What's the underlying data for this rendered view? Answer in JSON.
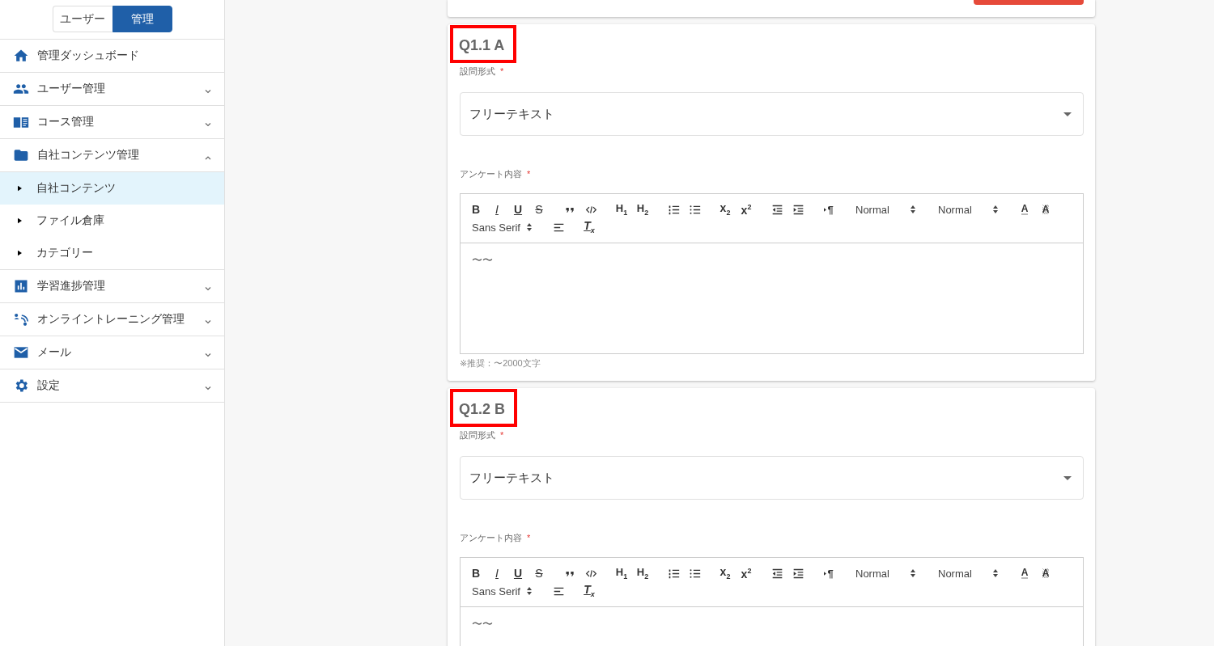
{
  "mode_toggle": [
    {
      "label": "ユーザー",
      "selected": false
    },
    {
      "label": "管理",
      "selected": true
    }
  ],
  "sidebar": {
    "items": [
      {
        "kind": "link",
        "label": "管理ダッシュボード"
      },
      {
        "kind": "group",
        "label": "ユーザー管理",
        "expanded": false
      },
      {
        "kind": "group",
        "label": "コース管理",
        "expanded": false
      },
      {
        "kind": "group",
        "label": "自社コンテンツ管理",
        "expanded": true,
        "children": [
          {
            "label": "自社コンテンツ",
            "selected": true
          },
          {
            "label": "ファイル倉庫",
            "selected": false
          },
          {
            "label": "カテゴリー",
            "selected": false
          }
        ]
      },
      {
        "kind": "group",
        "label": "学習進捗管理",
        "expanded": false
      },
      {
        "kind": "group",
        "label": "オンライントレーニング管理",
        "expanded": false
      },
      {
        "kind": "group",
        "label": "メール",
        "expanded": false
      },
      {
        "kind": "group",
        "label": "設定",
        "expanded": false
      }
    ]
  },
  "questions": [
    {
      "title": "Q1.1 A",
      "highlighted": true,
      "type_label": "設問形式",
      "type_required_mark": "*",
      "type_value": "フリーテキスト",
      "content_label": "アンケート内容",
      "content_required_mark": "*",
      "content": "〜〜",
      "hint": "※推奨：〜2000文字",
      "toolbar": [
        [
          {
            "kind": "bold",
            "glyph": "B"
          },
          {
            "kind": "italic",
            "glyph": "I"
          },
          {
            "kind": "underline",
            "glyph": "U"
          },
          {
            "kind": "strike",
            "glyph": "S"
          }
        ],
        [
          {
            "kind": "quote"
          },
          {
            "kind": "code"
          }
        ],
        [
          {
            "kind": "heading",
            "glyph": "H$_{1}$"
          },
          {
            "kind": "heading",
            "glyph": "H$_{2}$"
          }
        ],
        [
          {
            "kind": "ordered-list"
          },
          {
            "kind": "bullet-list"
          }
        ],
        [
          {
            "kind": "script",
            "glyph": "x$_{2}$"
          },
          {
            "kind": "script",
            "glyph": "x$^{2}$"
          }
        ],
        [
          {
            "kind": "outdent"
          },
          {
            "kind": "indent"
          }
        ],
        [
          {
            "kind": "direction",
            "glyph": "¶"
          }
        ],
        [
          {
            "kind": "picker",
            "label": "Normal"
          }
        ],
        [
          {
            "kind": "picker",
            "label": "Normal"
          }
        ],
        [
          {
            "kind": "color",
            "glyph": "A"
          },
          {
            "kind": "background",
            "glyph": "A"
          }
        ],
        [
          {
            "kind": "picker",
            "label": "Sans Serif"
          }
        ],
        [
          {
            "kind": "align"
          }
        ],
        [
          {
            "kind": "clean",
            "glyph": "T$_{x}$"
          }
        ]
      ]
    },
    {
      "title": "Q1.2 B",
      "highlighted": true,
      "type_label": "設問形式",
      "type_required_mark": "*",
      "type_value": "フリーテキスト",
      "content_label": "アンケート内容",
      "content_required_mark": "*",
      "content": "〜〜",
      "toolbar": [
        [
          {
            "kind": "bold",
            "glyph": "B"
          },
          {
            "kind": "italic",
            "glyph": "I"
          },
          {
            "kind": "underline",
            "glyph": "U"
          },
          {
            "kind": "strike",
            "glyph": "S"
          }
        ],
        [
          {
            "kind": "quote"
          },
          {
            "kind": "code"
          }
        ],
        [
          {
            "kind": "heading",
            "glyph": "H$_{1}$"
          },
          {
            "kind": "heading",
            "glyph": "H$_{2}$"
          }
        ],
        [
          {
            "kind": "ordered-list"
          },
          {
            "kind": "bullet-list"
          }
        ],
        [
          {
            "kind": "script",
            "glyph": "x$_{2}$"
          },
          {
            "kind": "script",
            "glyph": "x$^{2}$"
          }
        ],
        [
          {
            "kind": "outdent"
          },
          {
            "kind": "indent"
          }
        ],
        [
          {
            "kind": "direction",
            "glyph": "¶"
          }
        ],
        [
          {
            "kind": "picker",
            "label": "Normal"
          }
        ],
        [
          {
            "kind": "picker",
            "label": "Normal"
          }
        ],
        [
          {
            "kind": "color",
            "glyph": "A"
          },
          {
            "kind": "background",
            "glyph": "A"
          }
        ],
        [
          {
            "kind": "picker",
            "label": "Sans Serif"
          }
        ],
        [
          {
            "kind": "align"
          }
        ],
        [
          {
            "kind": "clean",
            "glyph": "T$_{x}$"
          }
        ]
      ]
    }
  ]
}
